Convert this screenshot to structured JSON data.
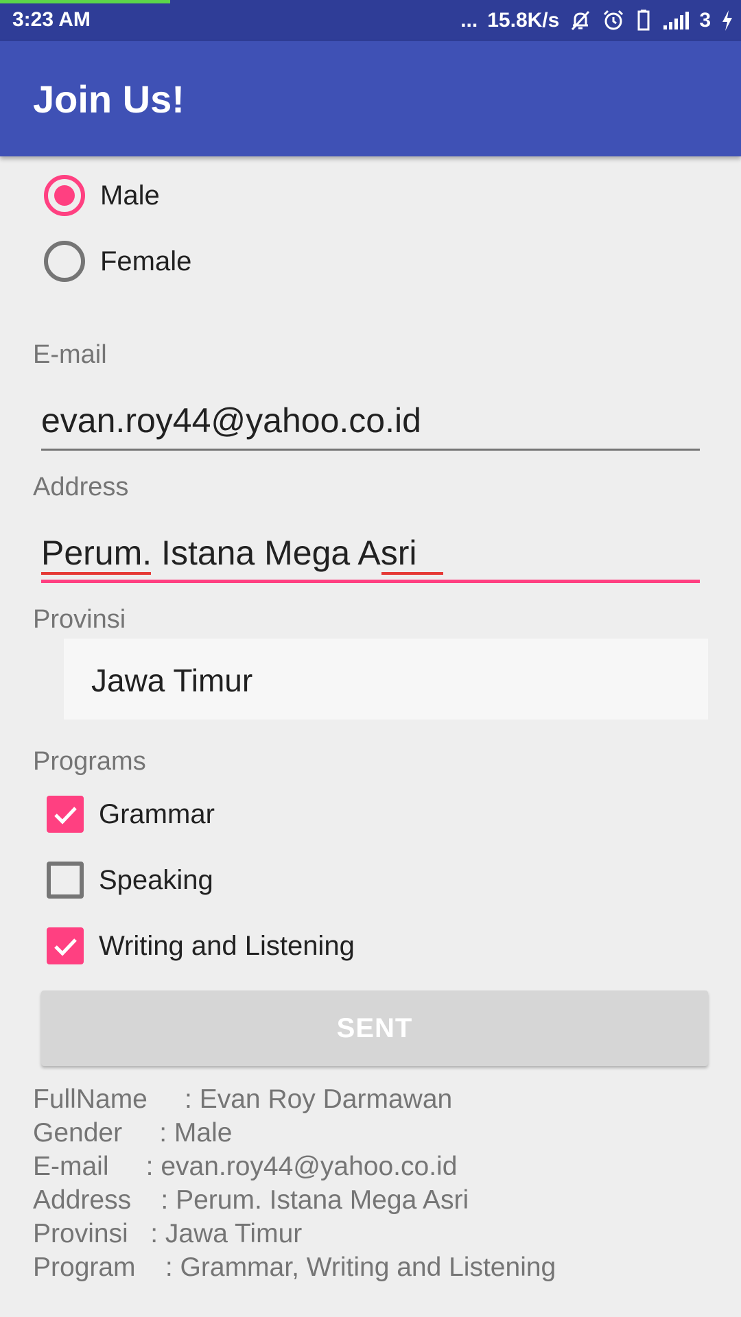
{
  "status_bar": {
    "time": "3:23 AM",
    "dots": "...",
    "network_speed": "15.8K/s",
    "signal_count": "3",
    "icons": [
      "mute-bell-icon",
      "alarm-icon",
      "sim-icon",
      "signal-icon",
      "charging-icon"
    ]
  },
  "app_bar": {
    "title": "Join Us!"
  },
  "gender": {
    "options": [
      {
        "label": "Male",
        "selected": true
      },
      {
        "label": "Female",
        "selected": false
      }
    ]
  },
  "email": {
    "label": "E-mail",
    "value": "evan.roy44@yahoo.co.id"
  },
  "address": {
    "label": "Address",
    "value_parts": [
      "Perum",
      ". Istana Mega ",
      "Asri"
    ]
  },
  "provinsi": {
    "label": "Provinsi",
    "selected": "Jawa Timur"
  },
  "programs": {
    "label": "Programs",
    "items": [
      {
        "label": "Grammar",
        "checked": true
      },
      {
        "label": "Speaking",
        "checked": false
      },
      {
        "label": "Writing and Listening",
        "checked": true
      }
    ]
  },
  "button": {
    "label": "SENT"
  },
  "summary": {
    "lines": [
      "FullName     : Evan Roy Darmawan",
      "Gender     : Male",
      "E-mail     : evan.roy44@yahoo.co.id",
      "Address    : Perum. Istana Mega Asri",
      "Provinsi   : Jawa Timur",
      "Program    : Grammar, Writing and Listening"
    ]
  },
  "colors": {
    "status_bar": "#2f3d97",
    "primary": "#3f51b5",
    "accent": "#ff4081",
    "background": "#eeeeee"
  }
}
